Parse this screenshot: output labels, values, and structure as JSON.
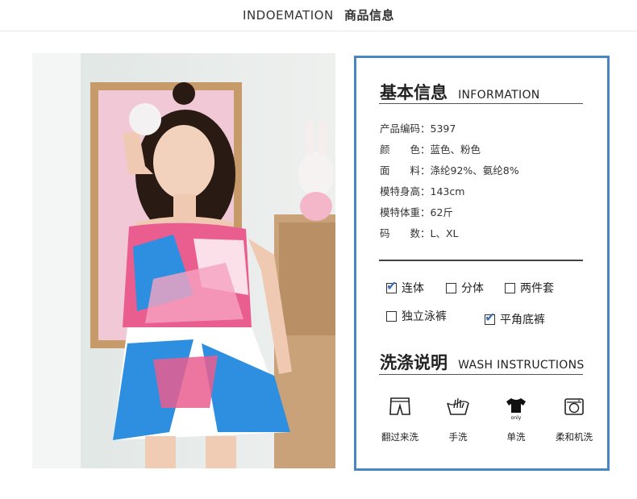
{
  "header": {
    "title_en": "INDOEMATION",
    "title_cn": "商品信息"
  },
  "basic_info": {
    "title_cn": "基本信息",
    "title_en": "INFORMATION",
    "rows": [
      {
        "label": "产品编码：",
        "value": "5397"
      },
      {
        "label": "颜　　色：",
        "value": "蓝色、粉色"
      },
      {
        "label": "面　　料：",
        "value": "涤纶92%、氨纶8%"
      },
      {
        "label": "模特身高：",
        "value": "143cm"
      },
      {
        "label": "模特体重：",
        "value": "62斤"
      },
      {
        "label": "码　　数：",
        "value": "L、XL"
      }
    ]
  },
  "style_options": [
    {
      "label": "连体",
      "checked": true
    },
    {
      "label": "分体",
      "checked": false
    },
    {
      "label": "两件套",
      "checked": false
    },
    {
      "label": "独立泳裤",
      "checked": false
    },
    {
      "label": "平角底裤",
      "checked": true
    }
  ],
  "wash": {
    "title_cn": "洗涤说明",
    "title_en": "WASH INSTRUCTIONS",
    "items": [
      {
        "label": "翻过来洗",
        "icon": "inside-out-shorts-icon"
      },
      {
        "label": "手洗",
        "icon": "hand-wash-icon"
      },
      {
        "label": "单洗",
        "icon": "wash-alone-shirt-icon",
        "icon_text": "only"
      },
      {
        "label": "柔和机洗",
        "icon": "gentle-machine-wash-icon"
      }
    ]
  },
  "colors": {
    "card_border": "#4a86c5",
    "check": "#3d6fb6"
  }
}
